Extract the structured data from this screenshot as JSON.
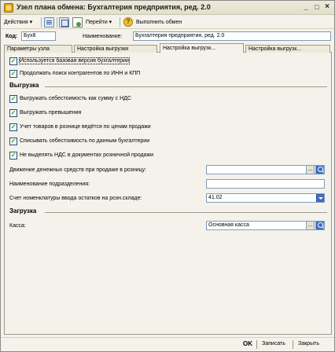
{
  "window": {
    "title": "Узел плана обмена: Бухгалтерия предприятия, ред. 2.0",
    "minimize": "_",
    "maximize": "□",
    "close": "×"
  },
  "toolbar": {
    "actions": "Действия ▾",
    "goto": "Перейти ▾",
    "help": "?",
    "execute": "Выполнить обмен"
  },
  "header": {
    "code_label": "Код:",
    "code_value": "Бух8",
    "name_label": "Наименование:",
    "name_value": "Бухгалтерия предприятия, ред. 2.0"
  },
  "tabs": [
    {
      "label": "Параметры узла",
      "active": false
    },
    {
      "label": "Настройка выгрузки",
      "active": false
    },
    {
      "label": "Настройка выгрузк...",
      "active": true
    },
    {
      "label": "Настройка выгрузк...",
      "active": false
    }
  ],
  "options": {
    "base_version": {
      "label": "Используется базовая версия бухгалтерии",
      "checked": true
    },
    "search_inn": {
      "label": "Продолжать поиск контрагентов по ИНН и КПП",
      "checked": true
    }
  },
  "export_group": {
    "title": "Выгрузка",
    "checks": [
      {
        "label": "Выгружать себестоимость как сумму с НДС",
        "checked": true
      },
      {
        "label": "Выгружать превышения",
        "checked": true
      },
      {
        "label": "Учет товаров в рознице ведётся по ценам продажи",
        "checked": true
      },
      {
        "label": "Списывать себестоимость по данным бухгалтерии",
        "checked": true
      },
      {
        "label": "Не выделять НДС в документах розничной продажи",
        "checked": true
      }
    ],
    "cash_flow_label": "Движение денежных средств при продаже в розницу:",
    "cash_flow_value": "",
    "division_label": "Наименование подразделения:",
    "division_value": "",
    "account_label": "Счет номенклатуры ввода остатков на розн.складе:",
    "account_value": "41.02"
  },
  "load_group": {
    "title": "Загрузка",
    "cash_label": "Касса:",
    "cash_value": "Основная касса"
  },
  "buttons": {
    "select": "...",
    "ok": "OK",
    "save": "Записать",
    "close": "Закрыть"
  }
}
